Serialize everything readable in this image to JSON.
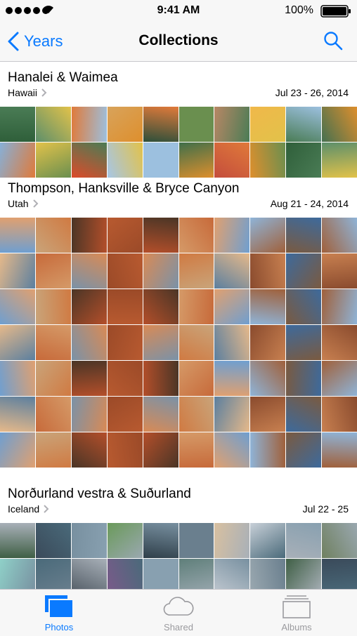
{
  "status_bar": {
    "time": "9:41 AM",
    "battery": "100%"
  },
  "nav": {
    "back_label": "Years",
    "title": "Collections"
  },
  "collections": [
    {
      "title": "Hanalei & Waimea",
      "location": "Hawaii",
      "date": "Jul 23 - 26, 2014",
      "rows": 2,
      "palette": [
        "#3f6f4a",
        "#86b0d8",
        "#6a8f4f",
        "#2f5f3a",
        "#a7c6e6",
        "#4a7c55",
        "#d8a35b",
        "#c44d3c",
        "#e2c24a",
        "#b88765",
        "#5c8f6b",
        "#9cc0df",
        "#447050",
        "#2c4f3a",
        "#de8f2d",
        "#dd4b2a",
        "#f0b84a",
        "#e07a3a"
      ]
    },
    {
      "title": "Thompson, Hanksville & Bryce Canyon",
      "location": "Utah",
      "date": "Aug 21 - 24, 2014",
      "rows": 7,
      "palette": [
        "#c76a3a",
        "#d98a55",
        "#8a4b2e",
        "#6f9fd0",
        "#b85a30",
        "#e0a070",
        "#a0603a",
        "#7a92a8",
        "#d07a42",
        "#3d6a9c",
        "#c9a47a",
        "#b44f2a",
        "#8fb4d8",
        "#e6b98a",
        "#9b4a28",
        "#5b7f9f",
        "#c88050",
        "#4a3526",
        "#d59a68",
        "#7a5a40"
      ]
    },
    {
      "title": "Norðurland vestra & Suðurland",
      "location": "Iceland",
      "date": "Jul 22 - 25",
      "rows": 2,
      "palette": [
        "#5f7f7a",
        "#8fd0c8",
        "#6a7f8e",
        "#3f5f45",
        "#7a5a8a",
        "#a8b0b8",
        "#6a9a5a",
        "#c0c8d0",
        "#4a6a7a",
        "#d8c0a0",
        "#3a4a5a",
        "#88a0b0",
        "#6f8060",
        "#2f3f4a",
        "#9aa8b0",
        "#505a64",
        "#c8d0d8",
        "#7890a0"
      ]
    }
  ],
  "tabs": [
    {
      "label": "Photos"
    },
    {
      "label": "Shared"
    },
    {
      "label": "Albums"
    }
  ],
  "colors": {
    "accent": "#0a7aff",
    "inactive": "#9a9a9e",
    "bar_bg": "#f7f7f7"
  }
}
